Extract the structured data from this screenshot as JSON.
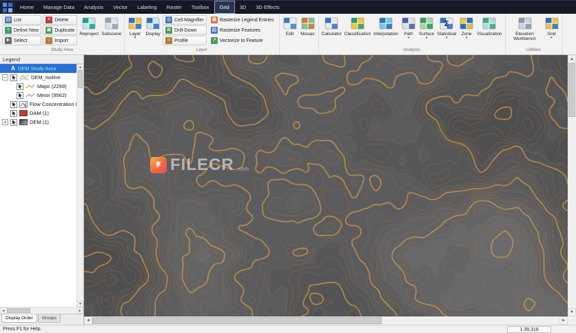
{
  "menubar": {
    "items": [
      "Home",
      "Manage Data",
      "Analysis",
      "Vector",
      "Labeling",
      "Raster",
      "Toolbox",
      "Grid",
      "3D",
      "3D Effects"
    ],
    "active": "Grid"
  },
  "ribbon_groups": [
    {
      "label": "Study Area",
      "sections": [
        {
          "type": "small",
          "buttons": [
            {
              "label": "List",
              "glyph": "▤",
              "color": "#4a78c0"
            },
            {
              "label": "Define New",
              "glyph": "+",
              "color": "#4a9e5f"
            },
            {
              "label": "Select",
              "glyph": "►",
              "color": "#6a6a6a"
            }
          ]
        },
        {
          "type": "small",
          "buttons": [
            {
              "label": "Delete",
              "glyph": "×",
              "color": "#c43c3c"
            },
            {
              "label": "Duplicate",
              "glyph": "▣",
              "color": "#4a9e5f"
            },
            {
              "label": "Import",
              "glyph": "↓",
              "color": "#b07c3a"
            }
          ]
        },
        {
          "type": "large",
          "buttons": [
            {
              "label": "Reproject",
              "c1": "#1f9e8e",
              "c2": "#bfe8e2"
            },
            {
              "label": "Subscene",
              "c1": "#8aa6b8",
              "c2": "#d7e4ec"
            }
          ]
        }
      ]
    },
    {
      "label": "Layer",
      "sections": [
        {
          "type": "large",
          "buttons": [
            {
              "label": "Layer",
              "c1": "#2f6fbf",
              "c2": "#f4c23c",
              "dropdown": true
            },
            {
              "label": "Display",
              "c1": "#2f6fbf",
              "c2": "#cfe3f7"
            }
          ]
        },
        {
          "type": "small",
          "buttons": [
            {
              "label": "Cell Magnifier",
              "glyph": "◎",
              "color": "#4a78c0"
            },
            {
              "label": "Drill-Down",
              "glyph": "⊞",
              "color": "#4a9e5f"
            },
            {
              "label": "Profile",
              "glyph": "≈",
              "color": "#b07c3a"
            }
          ]
        },
        {
          "type": "small",
          "flat": true,
          "buttons": [
            {
              "label": "Rasterize Legend Entries",
              "glyph": "▦",
              "color": "#d9763a"
            },
            {
              "label": "Rasterize Features",
              "glyph": "▨",
              "color": "#4a78c0"
            },
            {
              "label": "Vectorize to Feature",
              "glyph": "↗",
              "color": "#4a9e5f"
            }
          ]
        }
      ]
    },
    {
      "label": "",
      "sections": [
        {
          "type": "large",
          "buttons": [
            {
              "label": "Edit",
              "c1": "#3a78c9",
              "c2": "#e8eef6"
            },
            {
              "label": "Mosaic",
              "c1": "#d9763a",
              "c2": "#7fc48f"
            }
          ]
        }
      ]
    },
    {
      "label": "Analysis",
      "sections": [
        {
          "type": "large",
          "buttons": [
            {
              "label": "Calculator",
              "c1": "#3a6fc0",
              "c2": "#e8e8e8"
            },
            {
              "label": "Classification",
              "c1": "#2f9e55",
              "c2": "#f4c23c"
            },
            {
              "label": "Interpolation",
              "c1": "#2f6fbf",
              "c2": "#6fc9e8"
            },
            {
              "label": "Path",
              "c1": "#3a5fae",
              "c2": "#e0e0e0",
              "dropdown": true
            },
            {
              "label": "Surface",
              "c1": "#2f9e55",
              "c2": "#a8d8a8",
              "dropdown": true
            },
            {
              "label": "Statistical",
              "c1": "#2f6fbf",
              "c2": "#e8e8e8",
              "glyph": "Σ",
              "dropdown": true
            },
            {
              "label": "Zone",
              "c1": "#f4c23c",
              "c2": "#2f6fbf",
              "dropdown": true
            },
            {
              "label": "Visualization",
              "c1": "#3fae6f",
              "c2": "#a8d8f0"
            }
          ]
        }
      ]
    },
    {
      "label": "Utilities",
      "sections": [
        {
          "type": "large",
          "buttons": [
            {
              "label": "Elevation Workbench",
              "c1": "#8a97a8",
              "c2": "#c8d2de"
            },
            {
              "label": "Grid",
              "c1": "#2f6fbf",
              "c2": "#f4c23c",
              "dropdown": true
            }
          ]
        }
      ]
    }
  ],
  "legend": {
    "title": "Legend",
    "items": [
      {
        "label": "DEM Study Area",
        "icons": [
          "text-a"
        ],
        "selected": true,
        "level": 1
      },
      {
        "label": "DEM_Isoline",
        "icons": [
          "ca",
          "isoline"
        ],
        "level": 1,
        "expander": "minus"
      },
      {
        "label": "Major (2299)",
        "icons": [
          "ca",
          "line-orange"
        ],
        "level": 2
      },
      {
        "label": "Minor (9562)",
        "icons": [
          "ca",
          "line-gray"
        ],
        "level": 2
      },
      {
        "label": "Flow Concentration Res...",
        "icons": [
          "ca",
          "flow"
        ],
        "level": 1
      },
      {
        "label": "DAM (1)",
        "icons": [
          "ca",
          "swatch-red"
        ],
        "level": 1
      },
      {
        "label": "DEM (1)",
        "icons": [
          "ca",
          "raster"
        ],
        "level": 1,
        "expander": "plus"
      }
    ],
    "tabs": [
      {
        "label": "Display Order",
        "active": true
      },
      {
        "label": "Groups",
        "active": false
      }
    ]
  },
  "map": {
    "watermark": "FILECR",
    "watermark_suffix": ".com",
    "base_color": "#464648",
    "high_color": "#6f6f71",
    "minor_contour": "#a8793a",
    "major_contour": "#e9a23c",
    "levels": 26,
    "major_every": 5,
    "seed": 1337
  },
  "statusbar": {
    "help": "Press F1 for Help.",
    "scale": "1:39,318"
  }
}
